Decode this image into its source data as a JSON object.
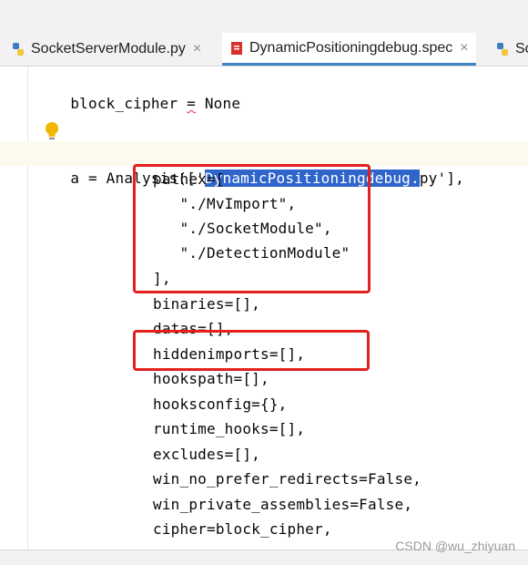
{
  "tabs": [
    {
      "label": "SocketServerModule.py",
      "close": "×",
      "icon": "python-file-icon"
    },
    {
      "label": "DynamicPositioningdebug.spec",
      "close": "×",
      "icon": "spec-file-icon",
      "active": true
    },
    {
      "label": "So",
      "icon": "python-file-icon"
    }
  ],
  "code": {
    "l1": {
      "a": "block_cipher ",
      "b": "=",
      "c": " None"
    },
    "l4": {
      "pre": "a = Analysis(['",
      "sel": "DynamicPositioningdebug.",
      "post": "py'],"
    },
    "lines": [
      "pathex=[",
      "   \"./MvImport\",",
      "   \"./SocketModule\",",
      "   \"./DetectionModule\"",
      "],",
      "binaries=[],",
      "datas=[],",
      "hiddenimports=[],",
      "hookspath=[],",
      "hooksconfig={},",
      "runtime_hooks=[],",
      "excludes=[],",
      "win_no_prefer_redirects=False,",
      "win_private_assemblies=False,",
      "cipher=block_cipher,"
    ]
  },
  "colors": {
    "highlight_box": "#e4201e",
    "selection": "#2f65ca",
    "tab_accent": "#4083c9"
  },
  "watermark": "CSDN @wu_zhiyuan"
}
